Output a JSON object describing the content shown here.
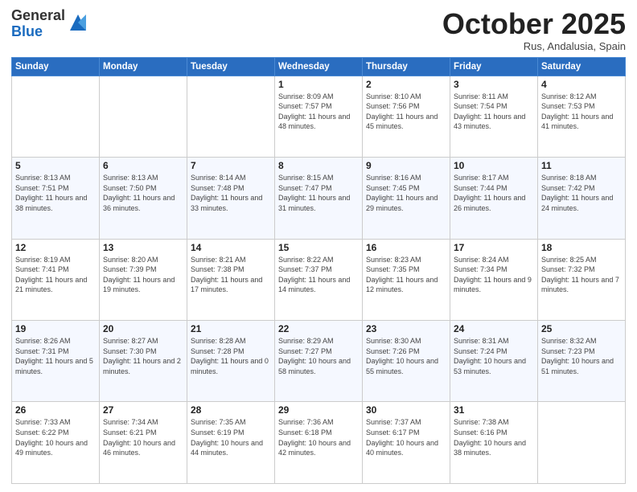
{
  "header": {
    "logo_general": "General",
    "logo_blue": "Blue",
    "month_title": "October 2025",
    "location": "Rus, Andalusia, Spain"
  },
  "days_of_week": [
    "Sunday",
    "Monday",
    "Tuesday",
    "Wednesday",
    "Thursday",
    "Friday",
    "Saturday"
  ],
  "weeks": [
    [
      {
        "day": "",
        "info": ""
      },
      {
        "day": "",
        "info": ""
      },
      {
        "day": "",
        "info": ""
      },
      {
        "day": "1",
        "info": "Sunrise: 8:09 AM\nSunset: 7:57 PM\nDaylight: 11 hours and 48 minutes."
      },
      {
        "day": "2",
        "info": "Sunrise: 8:10 AM\nSunset: 7:56 PM\nDaylight: 11 hours and 45 minutes."
      },
      {
        "day": "3",
        "info": "Sunrise: 8:11 AM\nSunset: 7:54 PM\nDaylight: 11 hours and 43 minutes."
      },
      {
        "day": "4",
        "info": "Sunrise: 8:12 AM\nSunset: 7:53 PM\nDaylight: 11 hours and 41 minutes."
      }
    ],
    [
      {
        "day": "5",
        "info": "Sunrise: 8:13 AM\nSunset: 7:51 PM\nDaylight: 11 hours and 38 minutes."
      },
      {
        "day": "6",
        "info": "Sunrise: 8:13 AM\nSunset: 7:50 PM\nDaylight: 11 hours and 36 minutes."
      },
      {
        "day": "7",
        "info": "Sunrise: 8:14 AM\nSunset: 7:48 PM\nDaylight: 11 hours and 33 minutes."
      },
      {
        "day": "8",
        "info": "Sunrise: 8:15 AM\nSunset: 7:47 PM\nDaylight: 11 hours and 31 minutes."
      },
      {
        "day": "9",
        "info": "Sunrise: 8:16 AM\nSunset: 7:45 PM\nDaylight: 11 hours and 29 minutes."
      },
      {
        "day": "10",
        "info": "Sunrise: 8:17 AM\nSunset: 7:44 PM\nDaylight: 11 hours and 26 minutes."
      },
      {
        "day": "11",
        "info": "Sunrise: 8:18 AM\nSunset: 7:42 PM\nDaylight: 11 hours and 24 minutes."
      }
    ],
    [
      {
        "day": "12",
        "info": "Sunrise: 8:19 AM\nSunset: 7:41 PM\nDaylight: 11 hours and 21 minutes."
      },
      {
        "day": "13",
        "info": "Sunrise: 8:20 AM\nSunset: 7:39 PM\nDaylight: 11 hours and 19 minutes."
      },
      {
        "day": "14",
        "info": "Sunrise: 8:21 AM\nSunset: 7:38 PM\nDaylight: 11 hours and 17 minutes."
      },
      {
        "day": "15",
        "info": "Sunrise: 8:22 AM\nSunset: 7:37 PM\nDaylight: 11 hours and 14 minutes."
      },
      {
        "day": "16",
        "info": "Sunrise: 8:23 AM\nSunset: 7:35 PM\nDaylight: 11 hours and 12 minutes."
      },
      {
        "day": "17",
        "info": "Sunrise: 8:24 AM\nSunset: 7:34 PM\nDaylight: 11 hours and 9 minutes."
      },
      {
        "day": "18",
        "info": "Sunrise: 8:25 AM\nSunset: 7:32 PM\nDaylight: 11 hours and 7 minutes."
      }
    ],
    [
      {
        "day": "19",
        "info": "Sunrise: 8:26 AM\nSunset: 7:31 PM\nDaylight: 11 hours and 5 minutes."
      },
      {
        "day": "20",
        "info": "Sunrise: 8:27 AM\nSunset: 7:30 PM\nDaylight: 11 hours and 2 minutes."
      },
      {
        "day": "21",
        "info": "Sunrise: 8:28 AM\nSunset: 7:28 PM\nDaylight: 11 hours and 0 minutes."
      },
      {
        "day": "22",
        "info": "Sunrise: 8:29 AM\nSunset: 7:27 PM\nDaylight: 10 hours and 58 minutes."
      },
      {
        "day": "23",
        "info": "Sunrise: 8:30 AM\nSunset: 7:26 PM\nDaylight: 10 hours and 55 minutes."
      },
      {
        "day": "24",
        "info": "Sunrise: 8:31 AM\nSunset: 7:24 PM\nDaylight: 10 hours and 53 minutes."
      },
      {
        "day": "25",
        "info": "Sunrise: 8:32 AM\nSunset: 7:23 PM\nDaylight: 10 hours and 51 minutes."
      }
    ],
    [
      {
        "day": "26",
        "info": "Sunrise: 7:33 AM\nSunset: 6:22 PM\nDaylight: 10 hours and 49 minutes."
      },
      {
        "day": "27",
        "info": "Sunrise: 7:34 AM\nSunset: 6:21 PM\nDaylight: 10 hours and 46 minutes."
      },
      {
        "day": "28",
        "info": "Sunrise: 7:35 AM\nSunset: 6:19 PM\nDaylight: 10 hours and 44 minutes."
      },
      {
        "day": "29",
        "info": "Sunrise: 7:36 AM\nSunset: 6:18 PM\nDaylight: 10 hours and 42 minutes."
      },
      {
        "day": "30",
        "info": "Sunrise: 7:37 AM\nSunset: 6:17 PM\nDaylight: 10 hours and 40 minutes."
      },
      {
        "day": "31",
        "info": "Sunrise: 7:38 AM\nSunset: 6:16 PM\nDaylight: 10 hours and 38 minutes."
      },
      {
        "day": "",
        "info": ""
      }
    ]
  ]
}
